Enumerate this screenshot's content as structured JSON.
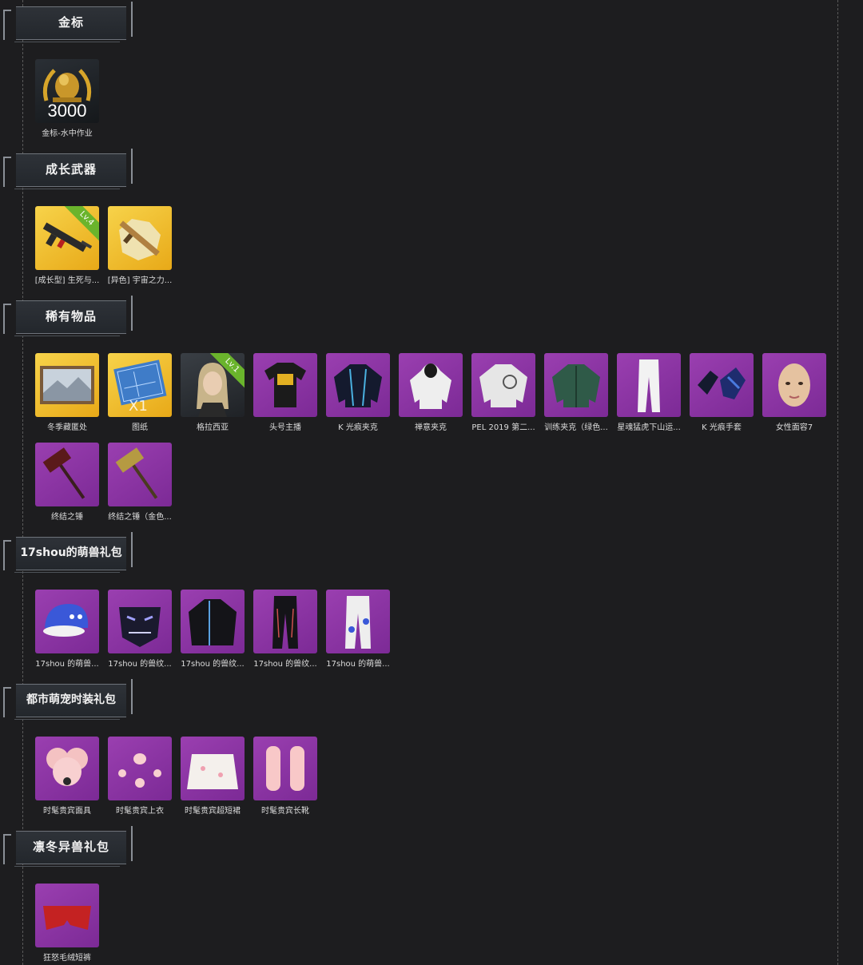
{
  "sections": [
    {
      "title": "金标",
      "items": [
        {
          "caption": "金标-水中作业",
          "tile": "dark",
          "icon": "gold-medal-icon",
          "count": "3000"
        }
      ]
    },
    {
      "title": "成长武器",
      "items": [
        {
          "caption": "[成长型] 生死与...",
          "tile": "gold",
          "icon": "rifle-icon",
          "ribbon": "Lv.4"
        },
        {
          "caption": "[异色] 宇宙之力...",
          "tile": "gold",
          "icon": "rifle-map-icon"
        }
      ]
    },
    {
      "title": "稀有物品",
      "items": [
        {
          "caption": "冬季藏匿处",
          "tile": "gold",
          "icon": "painting-icon"
        },
        {
          "caption": "图纸",
          "tile": "gold",
          "icon": "blueprint-icon",
          "count": "X1"
        },
        {
          "caption": "格拉西亚",
          "tile": "char",
          "icon": "character-icon",
          "ribbon": "Lv.1"
        },
        {
          "caption": "头号主播",
          "tile": "purple",
          "icon": "tshirt-icon"
        },
        {
          "caption": "K 光痕夹克",
          "tile": "purple",
          "icon": "jacket-icon"
        },
        {
          "caption": "禅意夹克",
          "tile": "purple",
          "icon": "hoodie-icon"
        },
        {
          "caption": "PEL 2019 第二...",
          "tile": "purple",
          "icon": "jacket-white-icon"
        },
        {
          "caption": "训练夹克（绿色...",
          "tile": "purple",
          "icon": "jacket-green-icon"
        },
        {
          "caption": "星魂猛虎下山运...",
          "tile": "purple",
          "icon": "pants-icon"
        },
        {
          "caption": "K 光痕手套",
          "tile": "purple",
          "icon": "gloves-icon"
        },
        {
          "caption": "女性面容7",
          "tile": "purple",
          "icon": "face-icon"
        },
        {
          "caption": "终结之锤",
          "tile": "purple",
          "icon": "hammer-icon"
        },
        {
          "caption": "终结之锤（金色...",
          "tile": "purple",
          "icon": "hammer-gold-icon"
        }
      ]
    },
    {
      "title": "17shou的萌兽礼包",
      "items": [
        {
          "caption": "17shou 的萌兽...",
          "tile": "purple",
          "icon": "cap-icon"
        },
        {
          "caption": "17shou 的兽纹...",
          "tile": "purple",
          "icon": "mask-icon"
        },
        {
          "caption": "17shou 的兽纹...",
          "tile": "purple",
          "icon": "coat-icon"
        },
        {
          "caption": "17shou 的兽纹...",
          "tile": "purple",
          "icon": "pants-black-icon"
        },
        {
          "caption": "17shou 的萌兽...",
          "tile": "purple",
          "icon": "pants-white-icon"
        }
      ]
    },
    {
      "title": "都市萌宠时装礼包",
      "items": [
        {
          "caption": "时髦贵宾面具",
          "tile": "purple",
          "icon": "poodle-mask-icon"
        },
        {
          "caption": "时髦贵宾上衣",
          "tile": "purple",
          "icon": "poodle-top-icon"
        },
        {
          "caption": "时髦贵宾超短裙",
          "tile": "purple",
          "icon": "poodle-skirt-icon"
        },
        {
          "caption": "时髦贵宾长靴",
          "tile": "purple",
          "icon": "poodle-boots-icon"
        }
      ]
    },
    {
      "title": "凛冬异兽礼包",
      "items": [
        {
          "caption": "狂怒毛绒短裤",
          "tile": "purple",
          "icon": "shorts-icon"
        }
      ]
    }
  ]
}
